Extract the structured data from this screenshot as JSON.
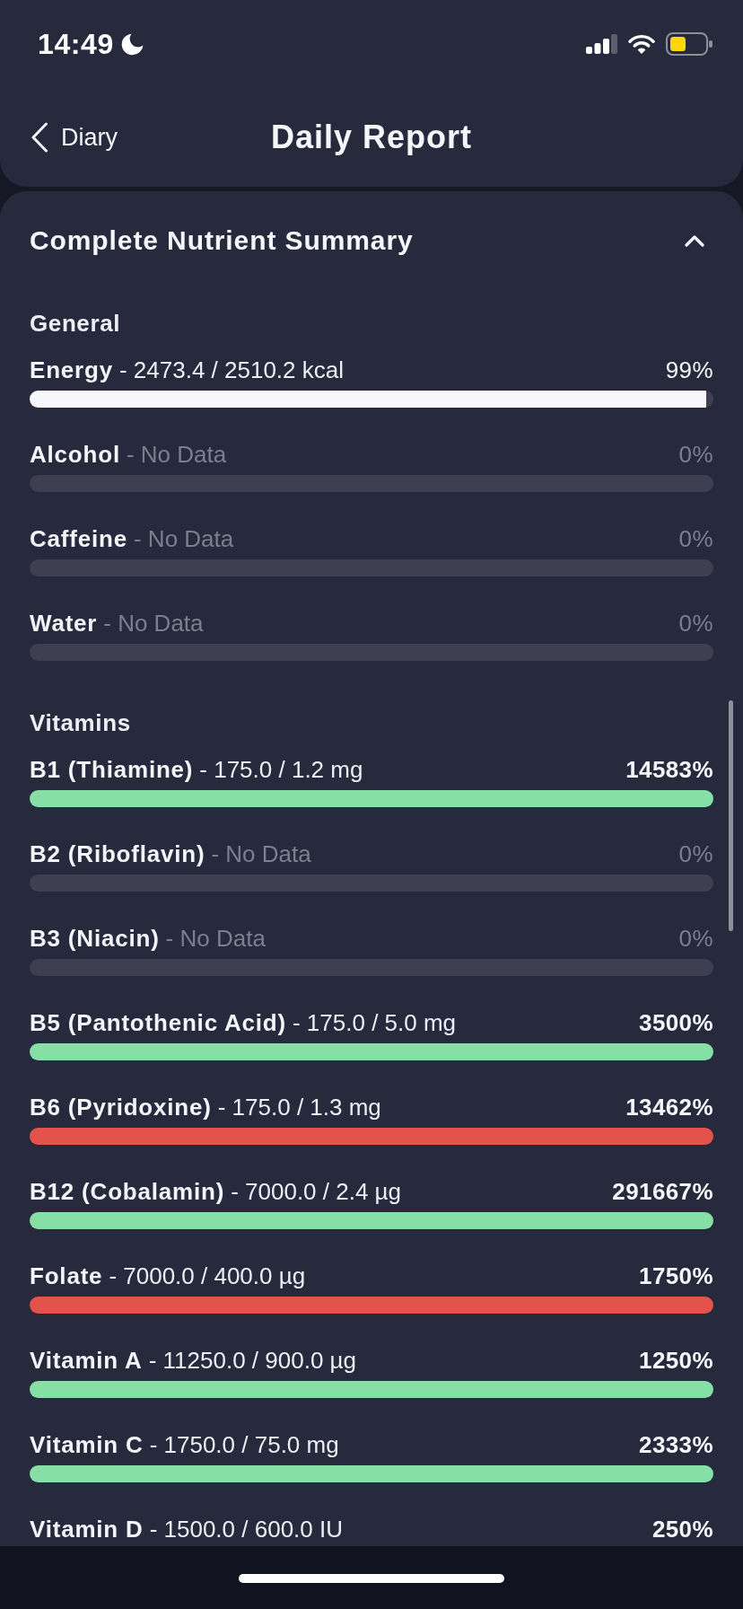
{
  "status_bar": {
    "time": "14:49"
  },
  "nav": {
    "back_label": "Diary",
    "title": "Daily Report"
  },
  "summary": {
    "title": "Complete Nutrient Summary",
    "expanded": true,
    "sections": [
      {
        "title": "General",
        "rows": [
          {
            "name": "Energy",
            "amount": "- 2473.4 / 2510.2 kcal",
            "percent": "99%",
            "kind": "under",
            "level": 0.99,
            "color": "#f7f7fb"
          },
          {
            "name": "Alcohol",
            "amount": "- No Data",
            "percent": "0%",
            "kind": "no_data"
          },
          {
            "name": "Caffeine",
            "amount": "- No Data",
            "percent": "0%",
            "kind": "no_data"
          },
          {
            "name": "Water",
            "amount": "- No Data",
            "percent": "0%",
            "kind": "no_data"
          }
        ]
      },
      {
        "title": "Vitamins",
        "rows": [
          {
            "name": "B1 (Thiamine)",
            "amount": "- 175.0 / 1.2 mg",
            "percent": "14583%",
            "kind": "over",
            "level": 1,
            "color": "#86dfa4"
          },
          {
            "name": "B2 (Riboflavin)",
            "amount": "- No Data",
            "percent": "0%",
            "kind": "no_data"
          },
          {
            "name": "B3 (Niacin)",
            "amount": "- No Data",
            "percent": "0%",
            "kind": "no_data"
          },
          {
            "name": "B5 (Pantothenic Acid)",
            "amount": "- 175.0 / 5.0 mg",
            "percent": "3500%",
            "kind": "over",
            "level": 1,
            "color": "#86dfa4"
          },
          {
            "name": "B6 (Pyridoxine)",
            "amount": "- 175.0 / 1.3 mg",
            "percent": "13462%",
            "kind": "over",
            "level": 1,
            "color": "#e3534b"
          },
          {
            "name": "B12 (Cobalamin)",
            "amount": "- 7000.0 / 2.4 µg",
            "percent": "291667%",
            "kind": "over",
            "level": 1,
            "color": "#86dfa4"
          },
          {
            "name": "Folate",
            "amount": "- 7000.0 / 400.0 µg",
            "percent": "1750%",
            "kind": "over",
            "level": 1,
            "color": "#e3534b"
          },
          {
            "name": "Vitamin A",
            "amount": "- 11250.0 / 900.0 µg",
            "percent": "1250%",
            "kind": "over",
            "level": 1,
            "color": "#86dfa4"
          },
          {
            "name": "Vitamin C",
            "amount": "- 1750.0 / 75.0 mg",
            "percent": "2333%",
            "kind": "over",
            "level": 1,
            "color": "#86dfa4"
          },
          {
            "name": "Vitamin D",
            "amount": "- 1500.0 / 600.0 IU",
            "percent": "250%",
            "kind": "over"
          }
        ]
      }
    ]
  }
}
